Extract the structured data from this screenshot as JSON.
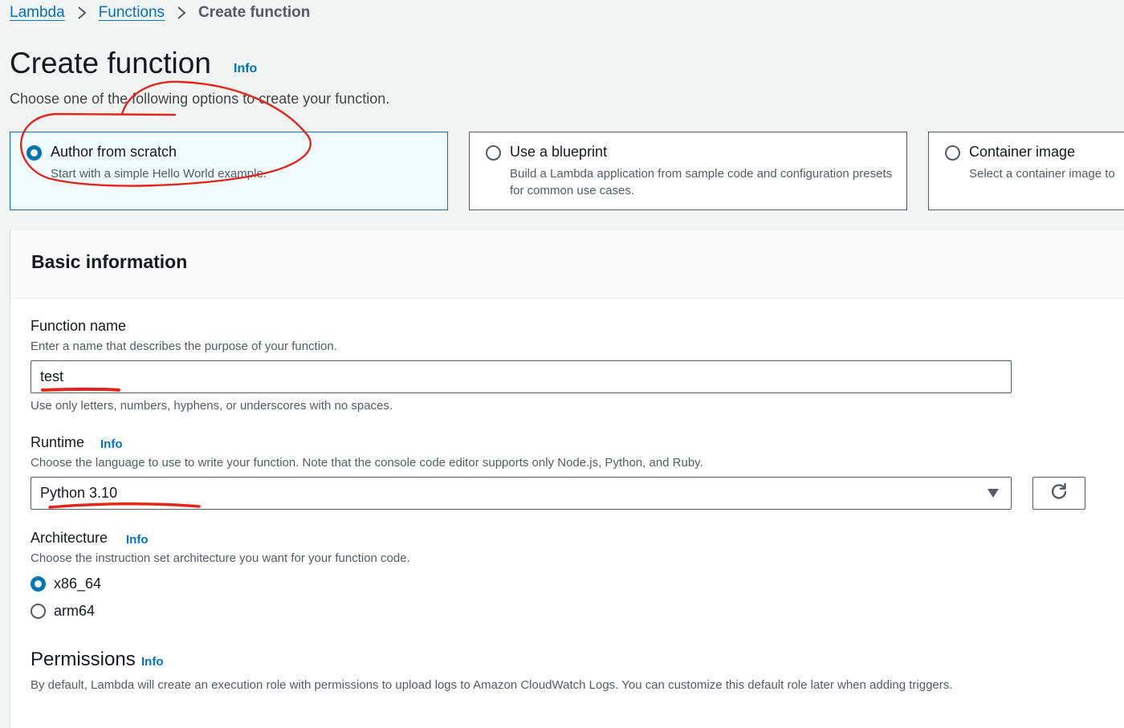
{
  "breadcrumb": {
    "items": [
      "Lambda",
      "Functions"
    ],
    "current": "Create function"
  },
  "page": {
    "title": "Create function",
    "title_info": "Info",
    "description": "Choose one of the following options to create your function."
  },
  "options": [
    {
      "title": "Author from scratch",
      "description": "Start with a simple Hello World example.",
      "selected": true
    },
    {
      "title": "Use a blueprint",
      "description": "Build a Lambda application from sample code and configuration presets for common use cases.",
      "selected": false
    },
    {
      "title": "Container image",
      "description": "Select a container image to",
      "selected": false
    }
  ],
  "basic_info": {
    "title": "Basic information",
    "function_name": {
      "label": "Function name",
      "description": "Enter a name that describes the purpose of your function.",
      "value": "test",
      "hint": "Use only letters, numbers, hyphens, or underscores with no spaces."
    },
    "runtime": {
      "label": "Runtime",
      "info": "Info",
      "description": "Choose the language to use to write your function. Note that the console code editor supports only Node.js, Python, and Ruby.",
      "selected": "Python 3.10",
      "refresh_icon": "refresh-icon"
    },
    "architecture": {
      "label": "Architecture",
      "info": "Info",
      "description": "Choose the instruction set architecture you want for your function code.",
      "options": [
        "x86_64",
        "arm64"
      ],
      "selected": "x86_64"
    },
    "permissions": {
      "title": "Permissions",
      "info": "Info",
      "description": "By default, Lambda will create an execution role with permissions to upload logs to Amazon CloudWatch Logs. You can customize this default role later when adding triggers."
    }
  },
  "colors": {
    "link": "#0073bb",
    "selected_card_bg": "#f1faff",
    "annotation": "#e3261b"
  }
}
